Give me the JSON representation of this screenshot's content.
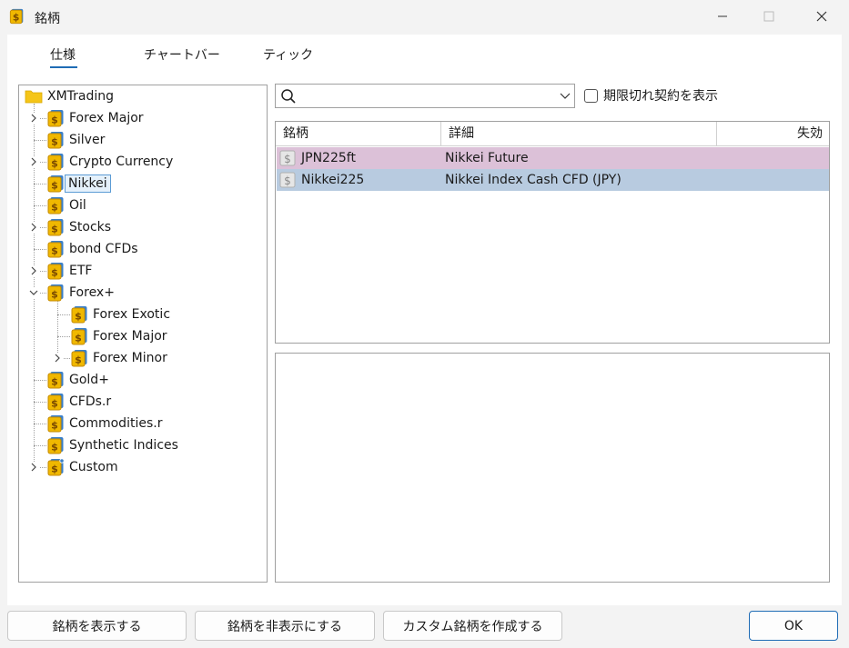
{
  "window": {
    "title": "銘柄"
  },
  "tabs": [
    {
      "label": "仕様",
      "active": true
    },
    {
      "label": "チャートバー",
      "active": false
    },
    {
      "label": "ティック",
      "active": false
    }
  ],
  "tree": {
    "root": "XMTrading",
    "items": [
      {
        "label": "Forex Major",
        "expandable": true,
        "expanded": false,
        "level": 1
      },
      {
        "label": "Silver",
        "expandable": false,
        "level": 1
      },
      {
        "label": "Crypto Currency",
        "expandable": true,
        "expanded": false,
        "level": 1
      },
      {
        "label": "Nikkei",
        "expandable": false,
        "level": 1,
        "selected": true
      },
      {
        "label": "Oil",
        "expandable": false,
        "level": 1
      },
      {
        "label": "Stocks",
        "expandable": true,
        "expanded": false,
        "level": 1
      },
      {
        "label": "bond CFDs",
        "expandable": false,
        "level": 1
      },
      {
        "label": "ETF",
        "expandable": true,
        "expanded": false,
        "level": 1
      },
      {
        "label": "Forex+",
        "expandable": true,
        "expanded": true,
        "level": 1
      },
      {
        "label": "Forex Exotic",
        "expandable": false,
        "level": 2
      },
      {
        "label": "Forex Major",
        "expandable": false,
        "level": 2
      },
      {
        "label": "Forex Minor",
        "expandable": true,
        "expanded": false,
        "level": 2
      },
      {
        "label": "Gold+",
        "expandable": false,
        "level": 1
      },
      {
        "label": "CFDs.r",
        "expandable": false,
        "level": 1
      },
      {
        "label": "Commodities.r",
        "expandable": false,
        "level": 1
      },
      {
        "label": "Synthetic Indices",
        "expandable": false,
        "level": 1
      },
      {
        "label": "Custom",
        "expandable": true,
        "expanded": false,
        "level": 1,
        "custom": true
      }
    ]
  },
  "search": {
    "value": "",
    "placeholder": ""
  },
  "show_expired": {
    "label": "期限切れ契約を表示",
    "checked": false
  },
  "table": {
    "columns": [
      "銘柄",
      "詳細",
      "失効"
    ],
    "rows": [
      {
        "symbol": "JPN225ft",
        "description": "Nikkei Future",
        "expiry": "",
        "color": "#dcc1d8"
      },
      {
        "symbol": "Nikkei225",
        "description": "Nikkei Index Cash CFD (JPY)",
        "expiry": "",
        "color": "#b8cbe0"
      }
    ]
  },
  "buttons": {
    "show": "銘柄を表示する",
    "hide": "銘柄を非表示にする",
    "create_custom": "カスタム銘柄を作成する",
    "ok": "OK"
  },
  "colors": {
    "accent": "#1f6cb5",
    "folder": "#f5c518",
    "symbol_gold": "#f0b800",
    "symbol_blue": "#3a7fc8"
  }
}
